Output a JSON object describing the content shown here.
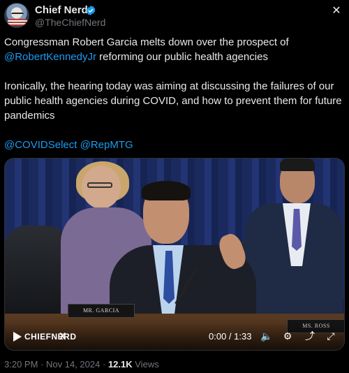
{
  "author": {
    "name": "Chief Nerd",
    "handle": "@TheChiefNerd",
    "verified": true
  },
  "tweet": {
    "line1_prefix": "Congressman Robert Garcia melts down over the prospect of ",
    "mention1": "@RobertKennedyJr",
    "line1_suffix": " reforming our public health agencies",
    "paragraph2": "Ironically, the hearing today was aiming at discussing the failures of our public health agencies during COVID, and how to prevent them for future pandemics",
    "mention2": "@COVIDSelect",
    "mention3": "@RepMTG"
  },
  "video": {
    "nameplate_left": "MR. GARCIA",
    "nameplate_right": "MS. ROSS",
    "brand": "CHIEFNERD",
    "brand_suffix": "X",
    "time": "0:00 / 1:33",
    "icons": [
      "play-icon",
      "volume-icon",
      "settings-icon",
      "share-icon",
      "fullscreen-icon"
    ]
  },
  "meta": {
    "time": "3:20 PM",
    "date": "Nov 14, 2024",
    "views_count": "12.1K",
    "views_label": "Views",
    "separator": "·"
  },
  "colors": {
    "accent": "#1d9bf0",
    "muted": "#71767b",
    "text": "#e7e9ea",
    "background": "#000000"
  }
}
